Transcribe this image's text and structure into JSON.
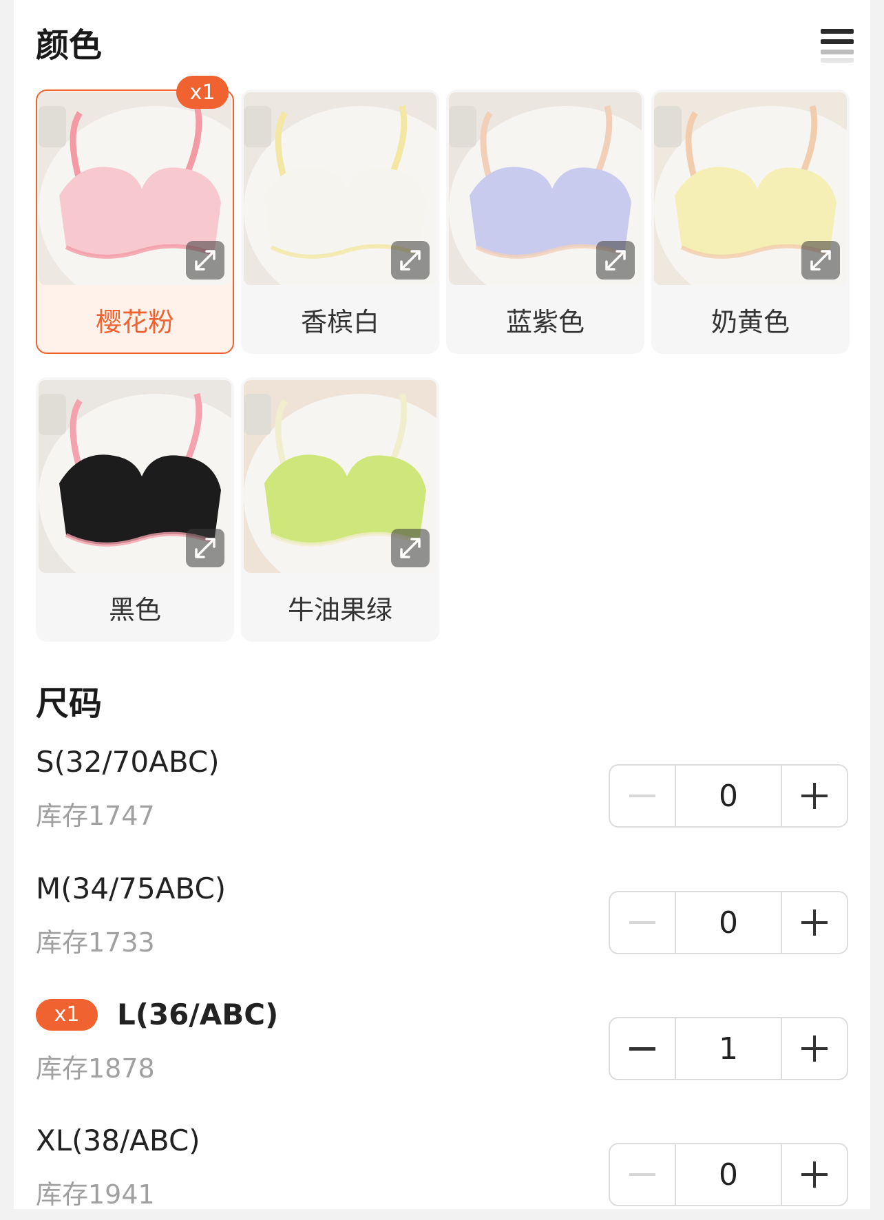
{
  "color_section": {
    "title": "颜色",
    "options": [
      {
        "label": "樱花粉",
        "selected": true,
        "badge": "x1",
        "bra_color": "#f7c9cf",
        "strap_color": "#f39aa5",
        "bg": "#ede8e2"
      },
      {
        "label": "香槟白",
        "selected": false,
        "badge": "",
        "bra_color": "#f6f4ee",
        "strap_color": "#f3e7a3",
        "bg": "#ece7e1"
      },
      {
        "label": "蓝紫色",
        "selected": false,
        "badge": "",
        "bra_color": "#c9cbee",
        "strap_color": "#f1cfb9",
        "bg": "#ece6e0"
      },
      {
        "label": "奶黄色",
        "selected": false,
        "badge": "",
        "bra_color": "#f5efb6",
        "strap_color": "#f1cdae",
        "bg": "#eee8df"
      },
      {
        "label": "黑色",
        "selected": false,
        "badge": "",
        "bra_color": "#1c1c1c",
        "strap_color": "#f4a3ae",
        "bg": "#eae6e2"
      },
      {
        "label": "牛油果绿",
        "selected": false,
        "badge": "",
        "bra_color": "#cfe67a",
        "strap_color": "#f0eecd",
        "bg": "#efe2d6"
      }
    ]
  },
  "size_section": {
    "title": "尺码",
    "rows": [
      {
        "name": "S(32/70ABC)",
        "stock": "库存1747",
        "quantity": "0",
        "badge": ""
      },
      {
        "name": "M(34/75ABC)",
        "stock": "库存1733",
        "quantity": "0",
        "badge": ""
      },
      {
        "name": "L(36/ABC)",
        "stock": "库存1878",
        "quantity": "1",
        "badge": "x1"
      },
      {
        "name": "XL(38/ABC)",
        "stock": "库存1941",
        "quantity": "0",
        "badge": ""
      }
    ]
  },
  "colors": {
    "accent": "#f0622f",
    "muted_text": "#a0a0a0"
  }
}
